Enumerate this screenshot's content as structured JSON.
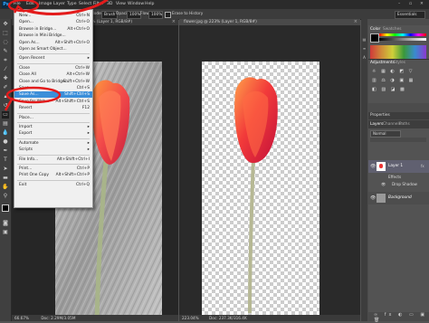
{
  "menubar": {
    "logo": "Ps",
    "items": [
      "File",
      "Edit",
      "Image",
      "Layer",
      "Type",
      "Select",
      "Filter",
      "3D",
      "View",
      "Window",
      "Help"
    ]
  },
  "options": {
    "mode_label": "Mode:",
    "mode_value": "Brush",
    "opacity_label": "Opacity:",
    "opacity_value": "100%",
    "flow_label": "Flow:",
    "flow_value": "100%",
    "erase_history": "Erase to History",
    "workspace": "Essentials"
  },
  "file_menu": {
    "items": [
      {
        "label": "New...",
        "shortcut": "Ctrl+N"
      },
      {
        "label": "Open...",
        "shortcut": "Ctrl+O"
      },
      {
        "label": "Browse in Bridge...",
        "shortcut": "Alt+Ctrl+O"
      },
      {
        "label": "Browse in Mini Bridge...",
        "shortcut": ""
      },
      {
        "label": "Open As...",
        "shortcut": "Alt+Shift+Ctrl+O"
      },
      {
        "label": "Open as Smart Object...",
        "shortcut": ""
      },
      {
        "label": "Open Recent",
        "shortcut": "▸"
      },
      {
        "label": "Close",
        "shortcut": "Ctrl+W"
      },
      {
        "label": "Close All",
        "shortcut": "Alt+Ctrl+W"
      },
      {
        "label": "Close and Go to Bridge...",
        "shortcut": "Shift+Ctrl+W"
      },
      {
        "label": "Save",
        "shortcut": "Ctrl+S"
      },
      {
        "label": "Save As...",
        "shortcut": "Shift+Ctrl+S"
      },
      {
        "label": "Save for Web...",
        "shortcut": "Alt+Shift+Ctrl+S"
      },
      {
        "label": "Revert",
        "shortcut": "F12"
      },
      {
        "label": "Place...",
        "shortcut": ""
      },
      {
        "label": "Import",
        "shortcut": "▸"
      },
      {
        "label": "Export",
        "shortcut": "▸"
      },
      {
        "label": "Automate",
        "shortcut": "▸"
      },
      {
        "label": "Scripts",
        "shortcut": "▸"
      },
      {
        "label": "File Info...",
        "shortcut": "Alt+Shift+Ctrl+I"
      },
      {
        "label": "Print...",
        "shortcut": "Ctrl+P"
      },
      {
        "label": "Print One Copy",
        "shortcut": "Alt+Shift+Ctrl+P"
      },
      {
        "label": "Exit",
        "shortcut": "Ctrl+Q"
      }
    ]
  },
  "documents": {
    "doc1_tab": "Flower.jpg @ 66.7% (Layer 1, RGB/8#)",
    "doc2_tab": "flower.jpg @ 223% (Layer 1, RGB/8#)",
    "doc1_zoom": "66.67%",
    "doc1_status": "Doc: 2.29M/3.05M",
    "doc2_zoom": "223.04%",
    "doc2_status": "Doc: 237.3K/316.4K"
  },
  "panels": {
    "tab_color": "Color",
    "tab_swatches": "Swatches",
    "tab_adjustments": "Adjustments",
    "tab_styles": "Styles",
    "properties": "Properties",
    "tab_layers": "Layers",
    "tab_channels": "Channels",
    "tab_paths": "Paths",
    "blend_mode": "Normal",
    "layers": [
      {
        "name": "Layer 1"
      },
      {
        "name": "Effects"
      },
      {
        "name": "Drop Shadow"
      },
      {
        "name": "Background"
      }
    ]
  },
  "colors": {
    "highlight": "#3b8fd9",
    "annotation": "#e31b1b"
  }
}
